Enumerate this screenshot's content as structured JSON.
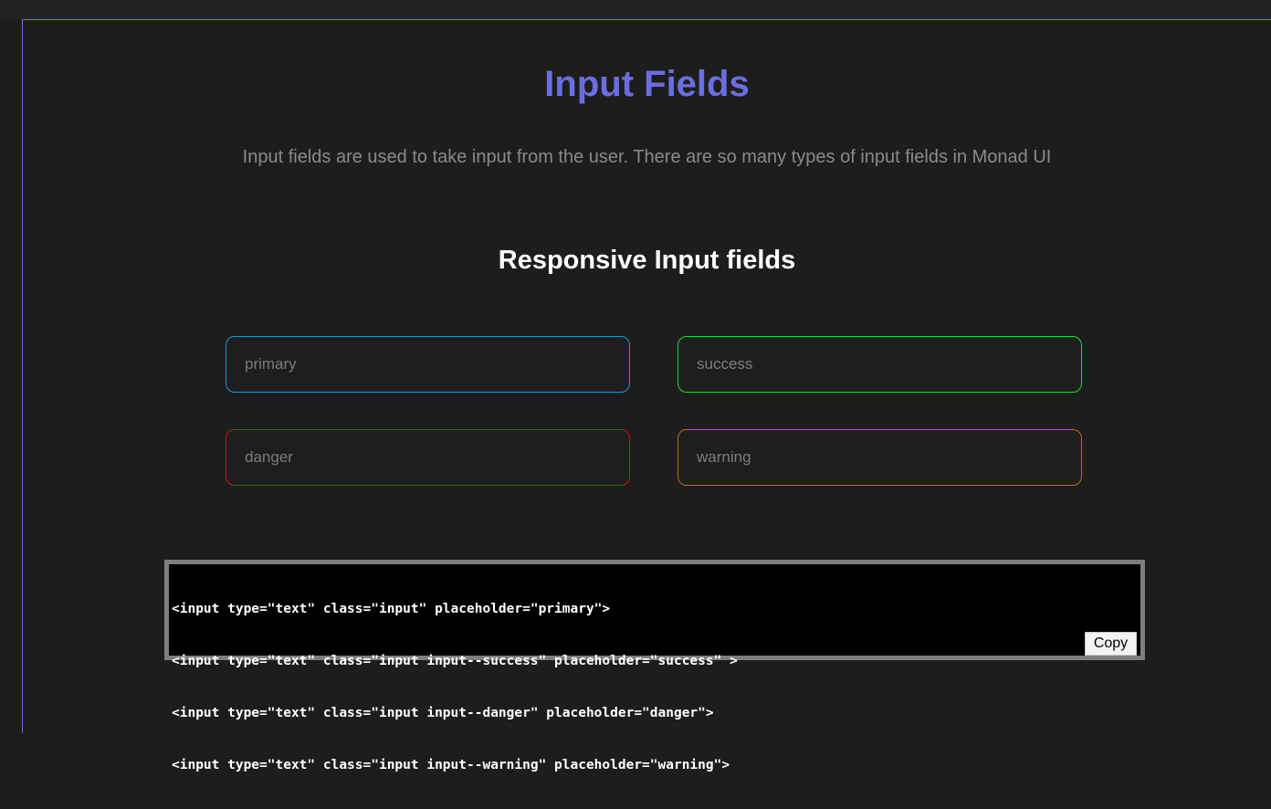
{
  "header": {
    "title": "Input Fields",
    "description": "Input fields are used to take input from the user. There are so many types of input fields in Monad UI"
  },
  "section": {
    "title": "Responsive Input fields"
  },
  "inputs": {
    "primary": {
      "placeholder": "primary",
      "value": "",
      "border_color": "#1a9bd6"
    },
    "success": {
      "placeholder": "success",
      "value": "",
      "border_color": "#1ed936"
    },
    "danger": {
      "placeholder": "danger",
      "value": "",
      "border_color": "#d01515"
    },
    "warning": {
      "placeholder": "warning",
      "value": "",
      "border_color": "#b86f12"
    }
  },
  "code": {
    "lines": [
      "<input type=\"text\" class=\"input\" placeholder=\"primary\">",
      "<input type=\"text\" class=\"input input--success\" placeholder=\"success\" >",
      "<input type=\"text\" class=\"input input--danger\" placeholder=\"danger\">",
      "<input type=\"text\" class=\"input input--warning\" placeholder=\"warning\">"
    ],
    "copy_label": "Copy"
  },
  "colors": {
    "background": "#1e1d1e",
    "accent": "#6a6ee0",
    "frame_border": "#6a6df0"
  }
}
